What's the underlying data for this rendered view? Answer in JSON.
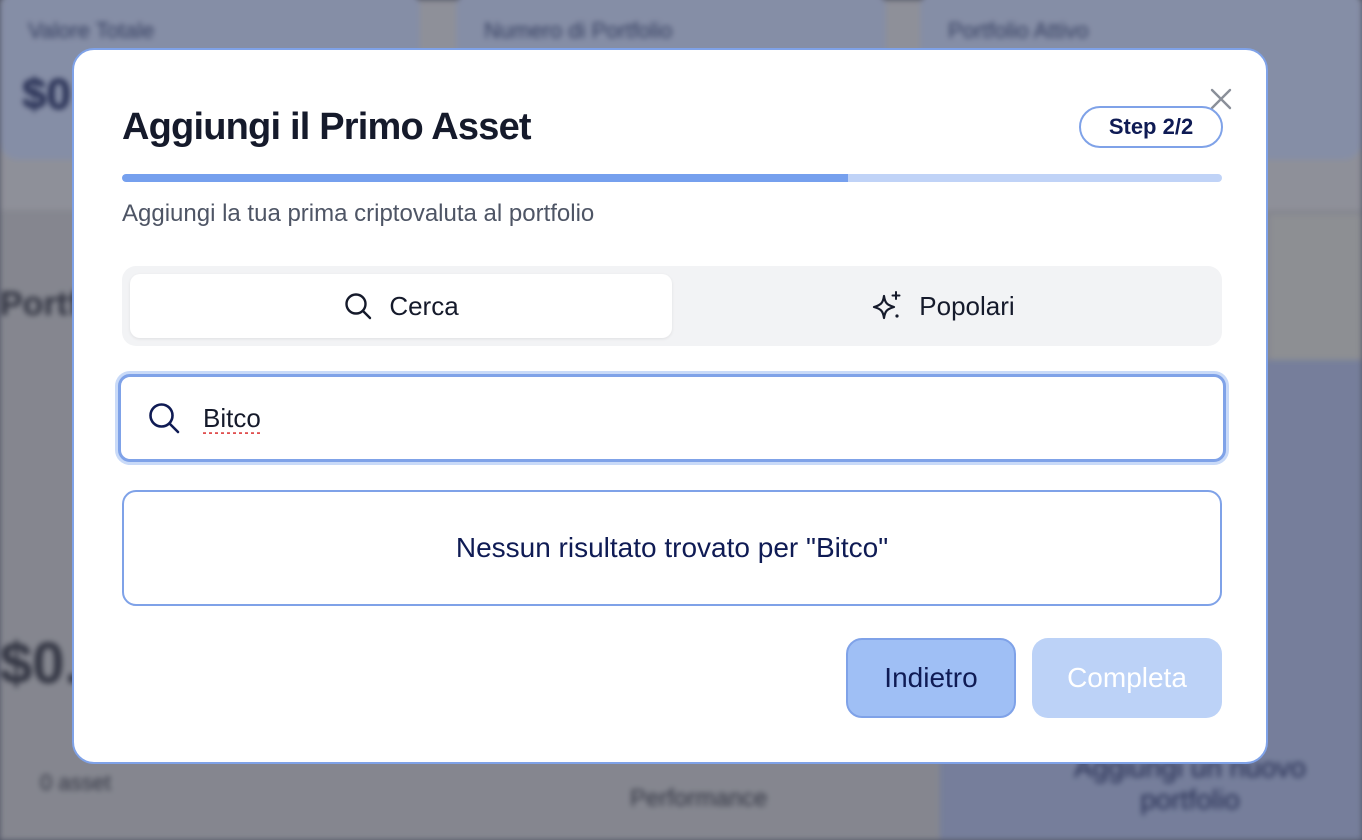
{
  "background": {
    "cards": [
      {
        "label": "Valore Totale",
        "value": "$0"
      },
      {
        "label": "Numero di Portfolio",
        "value": ""
      },
      {
        "label": "Portfolio Attivo",
        "value": ""
      }
    ],
    "section_title": "Portfolio",
    "bottom_left_value": "$0.",
    "bottom_left_caption": "0 asset",
    "bottom_mid_caption": "Performance",
    "bottom_right_caption": "Aggiungi un nuovo portfolio"
  },
  "modal": {
    "title": "Aggiungi il Primo Asset",
    "step_label": "Step 2/2",
    "progress_fraction": 0.66,
    "subtitle": "Aggiungi la tua prima criptovaluta al portfolio",
    "tabs": [
      {
        "label": "Cerca",
        "icon": "search-icon",
        "active": true
      },
      {
        "label": "Popolari",
        "icon": "sparkles-icon",
        "active": false
      }
    ],
    "search": {
      "value": "Bitco",
      "placeholder": ""
    },
    "results_message": "Nessun risultato trovato per \"Bitco\"",
    "buttons": {
      "back": "Indietro",
      "complete": "Completa"
    }
  },
  "colors": {
    "accent": "#7fa2e8",
    "progress_fill": "#76a0ee",
    "progress_track": "#c0d3f7",
    "text_dark": "#151a2b",
    "text_navy": "#0f1b54",
    "button_back": "#9fbff5",
    "button_complete_disabled": "#bcd2f7"
  }
}
